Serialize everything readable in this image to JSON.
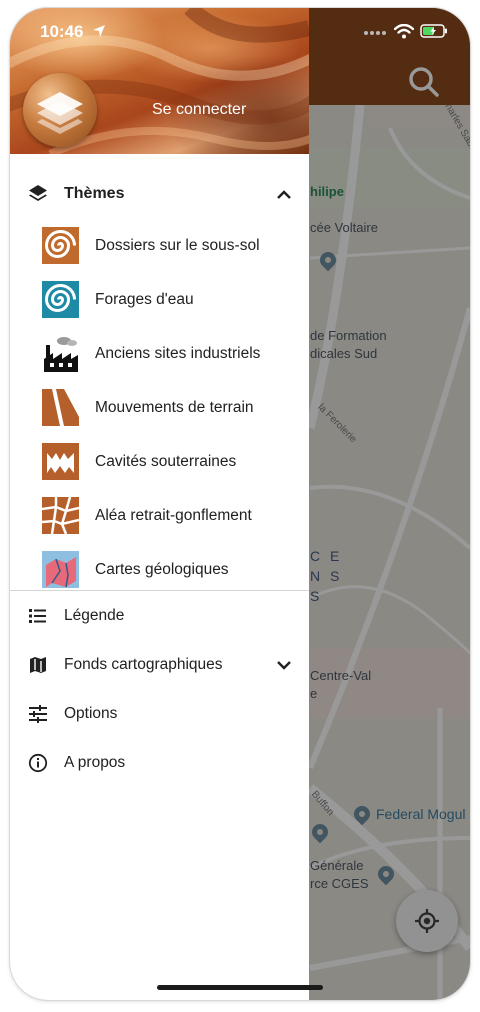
{
  "status_bar": {
    "time": "10:46"
  },
  "drawer": {
    "login_label": "Se connecter",
    "themes_section": {
      "label": "Thèmes",
      "items": [
        {
          "label": "Dossiers sur le sous-sol",
          "icon": "spiral-brown-icon"
        },
        {
          "label": "Forages d'eau",
          "icon": "spiral-blue-icon"
        },
        {
          "label": "Anciens sites industriels",
          "icon": "factory-icon"
        },
        {
          "label": "Mouvements de terrain",
          "icon": "landslide-icon"
        },
        {
          "label": "Cavités souterraines",
          "icon": "cave-icon"
        },
        {
          "label": "Aléa retrait-gonflement",
          "icon": "cracked-clay-icon"
        },
        {
          "label": "Cartes géologiques",
          "icon": "geologic-map-icon"
        }
      ]
    },
    "menu": [
      {
        "label": "Légende",
        "icon": "list-icon"
      },
      {
        "label": "Fonds cartographiques",
        "icon": "map-icon"
      },
      {
        "label": "Options",
        "icon": "sliders-icon"
      },
      {
        "label": "A propos",
        "icon": "info-icon"
      }
    ]
  },
  "map": {
    "labels": [
      {
        "text": "Charles Sabio"
      },
      {
        "text": "hilipe"
      },
      {
        "text": "cée Voltaire"
      },
      {
        "text": "de Formation"
      },
      {
        "text": "dicales Sud"
      },
      {
        "text": "la Ferolerie"
      },
      {
        "text": "C E"
      },
      {
        "text": "N S"
      },
      {
        "text": "S"
      },
      {
        "text": "Centre-Val"
      },
      {
        "text": "e"
      },
      {
        "text": "Buffon"
      },
      {
        "text": "Federal Mogul"
      },
      {
        "text": "Générale"
      },
      {
        "text": "rce CGES"
      }
    ]
  },
  "colors": {
    "app_bar": "#8a4a1f",
    "scrim": "rgba(0,0,0,0.40)",
    "drawer_bg": "#ffffff",
    "text_primary": "#212121"
  }
}
